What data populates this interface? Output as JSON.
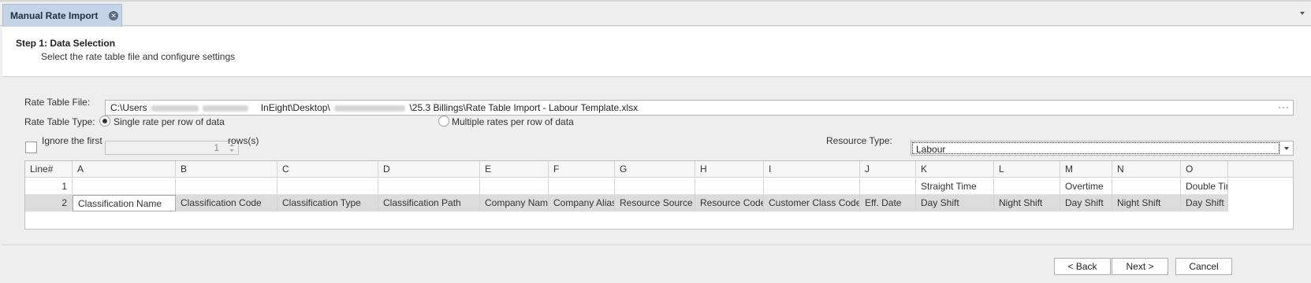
{
  "tab": {
    "title": "Manual Rate Import",
    "close_icon": "close-circle-icon"
  },
  "header": {
    "step_title": "Step 1: Data Selection",
    "step_subtitle": "Select the rate table file and configure settings"
  },
  "form": {
    "rate_table_file_label": "Rate Table File:",
    "file_path": {
      "prefix": "C:\\Users",
      "middle": "InEight\\Desktop\\",
      "suffix": "\\25.3 Billings\\Rate Table Import - Labour Template.xlsx",
      "browse": "···"
    },
    "rate_table_type_label": "Rate Table Type:",
    "option_single": "Single rate per row of data",
    "option_multiple": "Multiple rates per row of data",
    "selected_type": "single",
    "ignore_first_label": "Ignore the first",
    "ignore_first_value": "1",
    "rows_label": "rows(s)",
    "ignore_checked": false,
    "resource_type_label": "Resource Type:",
    "resource_type_value": "Labour"
  },
  "grid": {
    "columns": [
      "Line#",
      "A",
      "B",
      "C",
      "D",
      "E",
      "F",
      "G",
      "H",
      "I",
      "J",
      "K",
      "L",
      "M",
      "N",
      "O"
    ],
    "rows": [
      [
        "1",
        "",
        "",
        "",
        "",
        "",
        "",
        "",
        "",
        "",
        "",
        "Straight Time",
        "",
        "Overtime",
        "",
        "Double Tim"
      ],
      [
        "2",
        "Classification Name",
        "Classification Code",
        "Classification Type",
        "Classification Path",
        "Company Name",
        "Company Alias",
        "Resource Source",
        "Resource Code",
        "Customer Class Code",
        "Eff. Date",
        "Day Shift",
        "Night Shift",
        "Day Shift",
        "Night Shift",
        "Day Shift"
      ]
    ]
  },
  "buttons": {
    "back": "< Back",
    "next": "Next >",
    "cancel": "Cancel"
  }
}
